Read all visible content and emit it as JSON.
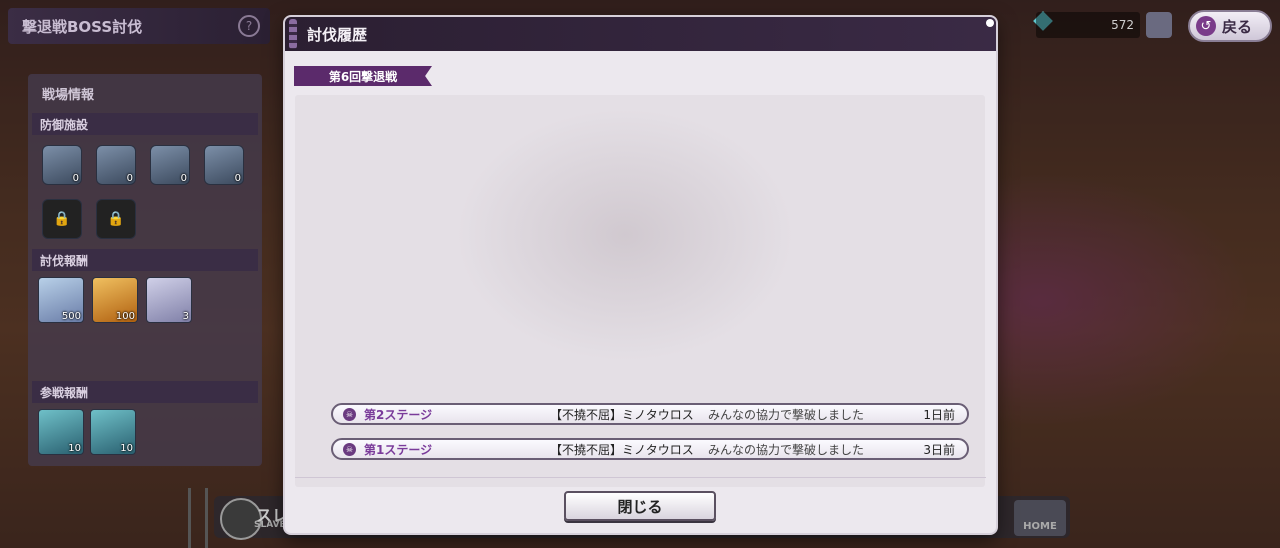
{
  "screen": {
    "title": "撃退戦BOSS討伐",
    "help_glyph": "?",
    "currency_value": "572",
    "back_label": "戻る",
    "back_glyph": "↺"
  },
  "side_panel": {
    "title": "戦場情報",
    "defense": {
      "title": "防御施設",
      "items": [
        {
          "icon": "shield-icon",
          "count": "0"
        },
        {
          "icon": "heart-shield-icon",
          "count": "0"
        },
        {
          "icon": "horn-icon",
          "count": "0"
        },
        {
          "icon": "dice-icon",
          "count": "0"
        },
        {
          "icon": "lock-icon",
          "count": ""
        },
        {
          "icon": "lock-icon",
          "count": ""
        }
      ]
    },
    "subjugation_reward": {
      "title": "討伐報酬",
      "items": [
        {
          "icon": "crystal-icon",
          "count": "500"
        },
        {
          "icon": "gold-ore-icon",
          "count": "100"
        },
        {
          "icon": "scroll-icon",
          "count": "3"
        }
      ]
    },
    "participation_reward": {
      "title": "参戦報酬",
      "items": [
        {
          "icon": "tile-icon",
          "count": "10"
        },
        {
          "icon": "crystal-shard-icon",
          "count": "10"
        }
      ]
    }
  },
  "bottom_nav": {
    "slave_label": "スレイ",
    "slave_sub": "SLAVE",
    "home_label": "HOME"
  },
  "modal": {
    "title": "討伐履歴",
    "ribbon": "第6回撃退戦",
    "entries": [
      {
        "stage": "第2ステージ",
        "boss": "【不撓不屈】ミノタウロス",
        "message": "みんなの協力で撃破しました",
        "ago": "1日前"
      },
      {
        "stage": "第1ステージ",
        "boss": "【不撓不屈】ミノタウロス",
        "message": "みんなの協力で撃破しました",
        "ago": "3日前"
      }
    ],
    "close_label": "閉じる"
  },
  "colors": {
    "accent": "#5b2a6b",
    "stage_text": "#7a3b9a",
    "header_bg": "#2b1f32"
  }
}
